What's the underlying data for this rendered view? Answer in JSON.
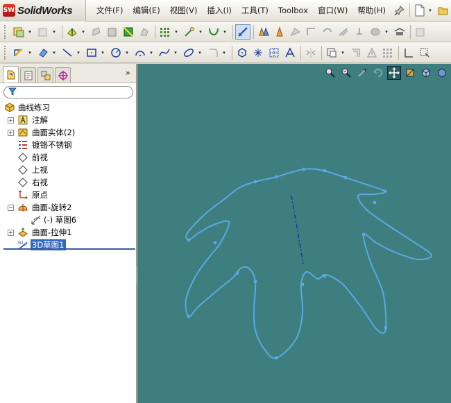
{
  "app": {
    "brand": "SolidWorks",
    "logo_mark": "SW"
  },
  "menubar": {
    "items": [
      "文件(F)",
      "编辑(E)",
      "视图(V)",
      "插入(I)",
      "工具(T)",
      "Toolbox",
      "窗口(W)",
      "帮助(H)"
    ],
    "tail_icons": [
      "pin-icon",
      "new-document-icon",
      "open-folder-icon"
    ]
  },
  "toolbar1": {
    "icons": [
      "sketch-3d-icon",
      "sketch-grayed-icon",
      "surface-extrude-icon",
      "surface-revolve-icon",
      "surface-sweep-icon",
      "surface-loft-icon",
      "boundary-surface-icon",
      "fill-surface-icon",
      "pattern-grid-icon",
      "reference-point-icon",
      "curve-icon",
      "sketch-3d-active-icon",
      "offset-surface-icon",
      "ruled-surface-icon",
      "untrim-surface-icon",
      "extend-surface-icon",
      "trim-surface-icon",
      "knit-surface-icon",
      "thicken-icon",
      "delete-face-icon",
      "toolbox-icon",
      "view-icon"
    ]
  },
  "toolbar2": {
    "icons": [
      "smart-dimension-icon",
      "relation-icon",
      "line-icon",
      "rectangle-icon",
      "circle-icon",
      "arc-icon",
      "spline-icon",
      "ellipse-icon",
      "fillet-icon",
      "polygon-icon",
      "point-icon",
      "grid-icon",
      "text-icon",
      "mirror-icon",
      "convert-entities-icon",
      "offset-entities-icon",
      "construction-icon",
      "linear-pattern-icon",
      "display-relations-icon",
      "repair-icon"
    ]
  },
  "feature_manager": {
    "tabs": [
      "feature-manager-tab",
      "property-manager-tab",
      "configuration-manager-tab",
      "dim-xpert-tab"
    ],
    "more_label": "»",
    "filter_icon": "filter-icon",
    "tree": [
      {
        "label": "曲线练习",
        "icon": "part-icon",
        "expander": "",
        "level": 0
      },
      {
        "label": "注解",
        "icon": "annotations-icon",
        "expander": "+",
        "level": 1
      },
      {
        "label": "曲面实体(2)",
        "icon": "surface-bodies-icon",
        "expander": "+",
        "level": 1
      },
      {
        "label": "镀铬不锈钢",
        "icon": "material-icon",
        "expander": "",
        "level": 1
      },
      {
        "label": "前视",
        "icon": "plane-icon",
        "expander": "",
        "level": 1
      },
      {
        "label": "上视",
        "icon": "plane-icon",
        "expander": "",
        "level": 1
      },
      {
        "label": "右视",
        "icon": "plane-icon",
        "expander": "",
        "level": 1
      },
      {
        "label": "原点",
        "icon": "origin-icon",
        "expander": "",
        "level": 1
      },
      {
        "label": "曲面-旋转2",
        "icon": "revolve-surface-icon",
        "expander": "−",
        "level": 1
      },
      {
        "label": "(-) 草图6",
        "icon": "sketch-icon",
        "expander": "",
        "level": 2
      },
      {
        "label": "曲面-拉伸1",
        "icon": "extrude-surface-icon",
        "expander": "+",
        "level": 1
      },
      {
        "label": "3D草图1",
        "icon": "sketch-3d-icon",
        "expander": "",
        "level": 1,
        "selected": true
      }
    ]
  },
  "viewport": {
    "background": "#3f7e7e",
    "curve_color": "#5aa9e6",
    "axis_color": "#1133aa",
    "heads_up_icons": [
      "zoom-to-fit-icon",
      "zoom-area-icon",
      "previous-view-icon",
      "rotate-icon",
      "pan-icon",
      "section-view-icon",
      "view-orientation-icon",
      "display-style-icon"
    ]
  }
}
